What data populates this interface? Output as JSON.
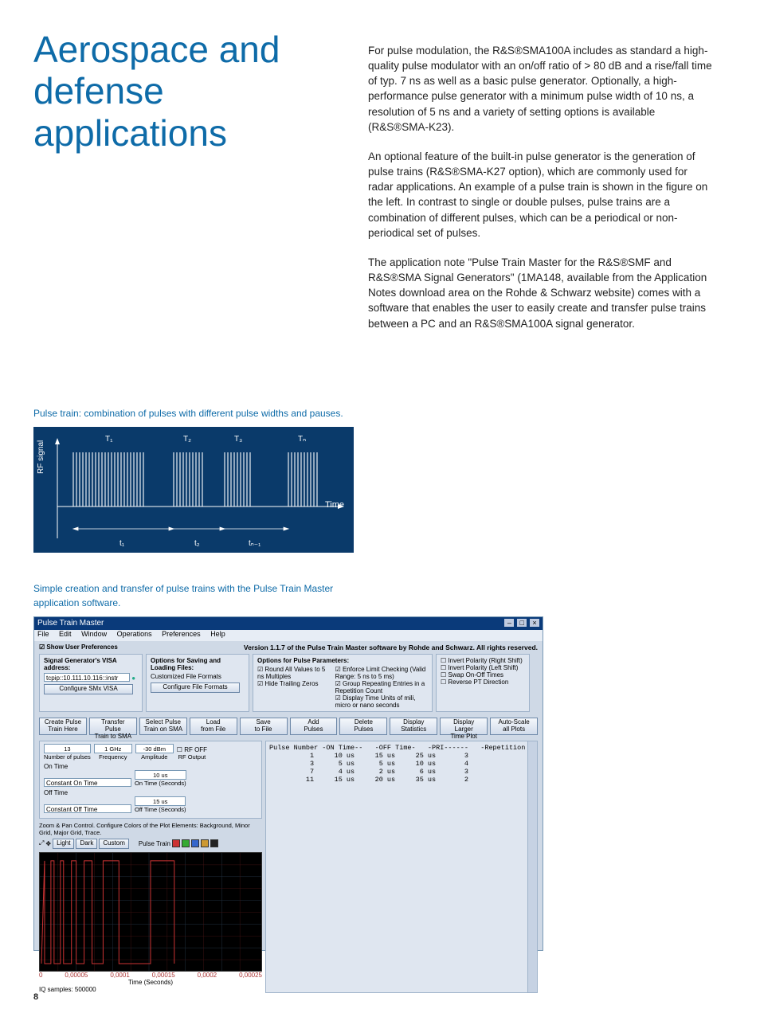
{
  "pageTitle": "Aerospace and defense applications",
  "pageNumber": "8",
  "paragraphs": [
    "For pulse modulation, the R&S®SMA100A includes as standard a high-quality pulse modulator with an on/off ratio of > 80 dB and a rise/fall time of typ. 7 ns as well as a basic pulse generator. Optionally, a high-performance pulse generator with a minimum pulse width of 10 ns, a resolution of 5 ns and a variety of setting options is available (R&S®SMA-K23).",
    "An optional feature of the built-in pulse generator is the generation of pulse trains (R&S®SMA-K27 option), which are commonly used for radar applications. An example of a pulse train is shown in the figure on the left. In contrast to single or double pulses, pulse trains are a combination of different pulses, which can be a periodical or non-periodical set of pulses.",
    "The application note \"Pulse Train Master for the R&S®SMF and R&S®SMA Signal Generators\" (1MA148, available from the Application Notes download area on the Rohde & Schwarz website) comes with a software that enables the user to easily create and transfer pulse trains between a PC and an R&S®SMA100A signal generator."
  ],
  "caption1": "Pulse train: combination of pulses with different pulse widths and pauses.",
  "caption2": "Simple creation and transfer of pulse trains with the Pulse Train Master application software.",
  "pulseDiagram": {
    "yLabel": "RF signal",
    "xLabel": "Time",
    "topLabels": [
      "T₁",
      "T₂",
      "T₃",
      "Tₙ"
    ],
    "bottomLabels": [
      "t₁",
      "t₂",
      "tₙ₋₁"
    ]
  },
  "chart_data": {
    "type": "table",
    "title": "Pulse train parameter list",
    "columns": [
      "Pulse Number",
      "-ON Time--",
      "-OFF Time-",
      "-PRI------",
      "-Repetition"
    ],
    "rows": [
      [
        "1",
        "10 us",
        "15 us",
        "25 us",
        "3"
      ],
      [
        "3",
        "5 us",
        "5 us",
        "10 us",
        "4"
      ],
      [
        "7",
        "4 us",
        "2 us",
        "6 us",
        "3"
      ],
      [
        "11",
        "15 us",
        "20 us",
        "35 us",
        "2"
      ]
    ],
    "plot": {
      "type": "line",
      "xlabel": "Time (Seconds)",
      "x_ticks": [
        "0",
        "0,00005",
        "0,0001",
        "0,00015",
        "0,0002",
        "0,00025"
      ],
      "iq_samples": "500000"
    }
  },
  "screenshot": {
    "title": "Pulse Train Master",
    "menu": [
      "File",
      "Edit",
      "Window",
      "Operations",
      "Preferences",
      "Help"
    ],
    "showPrefs": "Show User Preferences",
    "version": "Version 1.1.7 of the Pulse Train Master software by Rohde and Schwarz. All rights reserved.",
    "panel1": {
      "header": "Signal Generator's VISA address:",
      "value": "tcpip::10.111.10.116::instr",
      "button": "Configure SMx VISA"
    },
    "panel2": {
      "header": "Options for Saving and Loading Files:",
      "line": "Customized File Formats",
      "button": "Configure File Formats"
    },
    "panel3": {
      "header": "Options for Pulse Parameters:",
      "checks": [
        "Enforce Limit Checking (Valid Range: 5 ns to 5 ms)",
        "Round All Values to 5 ns Multiples",
        "Group Repeating Entries in a Repetition Count",
        "Hide Trailing Zeros",
        "Display Time Units of mili, micro or nano seconds"
      ]
    },
    "panel4": {
      "checks": [
        "Invert Polarity (Right Shift)",
        "Invert Polarity (Left Shift)",
        "Swap On-Off Times",
        "Reverse PT Direction"
      ]
    },
    "buttons": [
      "Create Pulse\nTrain Here",
      "Transfer Pulse\nTrain to SMA",
      "Select Pulse\nTrain on SMA",
      "Load\nfrom File",
      "Save\nto File",
      "Add\nPulses",
      "Delete\nPulses",
      "Display\nStatistics",
      "Display Larger\nTime Plot",
      "Auto-Scale\nall Plots"
    ],
    "leftFields": {
      "row1": [
        {
          "value": "13",
          "label": "Number of pulses"
        },
        {
          "value": "1 GHz",
          "label": "Frequency"
        },
        {
          "value": "-30 dBm",
          "label": "Amplitude"
        },
        {
          "checkbox": "RF OFF",
          "sub": "RF Output"
        }
      ],
      "onTimeLabel": "On Time",
      "onTimeOption": "Constant On Time",
      "onTimeValue": "10 us",
      "onTimeValueLabel": "On Time (Seconds)",
      "offTimeLabel": "Off Time",
      "offTimeOption": "Constant Off Time",
      "offTimeValue": "15 us",
      "offTimeValueLabel": "Off Time (Seconds)"
    },
    "note": "Zoom & Pan Control. Configure Colors of the Plot Elements: Background, Minor Grid, Major Grid, Trace.",
    "themeButtons": [
      "Light",
      "Dark",
      "Custom"
    ],
    "plotLegend": "Pulse Train",
    "plotColors": [
      "#cc3333",
      "#33aa33",
      "#3366cc",
      "#cc9933",
      "#222"
    ],
    "xlabel": "Time (Seconds)",
    "iqSamples": "IQ samples: 500000",
    "xticks": [
      "0",
      "0,00005",
      "0,0001",
      "0,00015",
      "0,0002",
      "0,00025"
    ]
  }
}
